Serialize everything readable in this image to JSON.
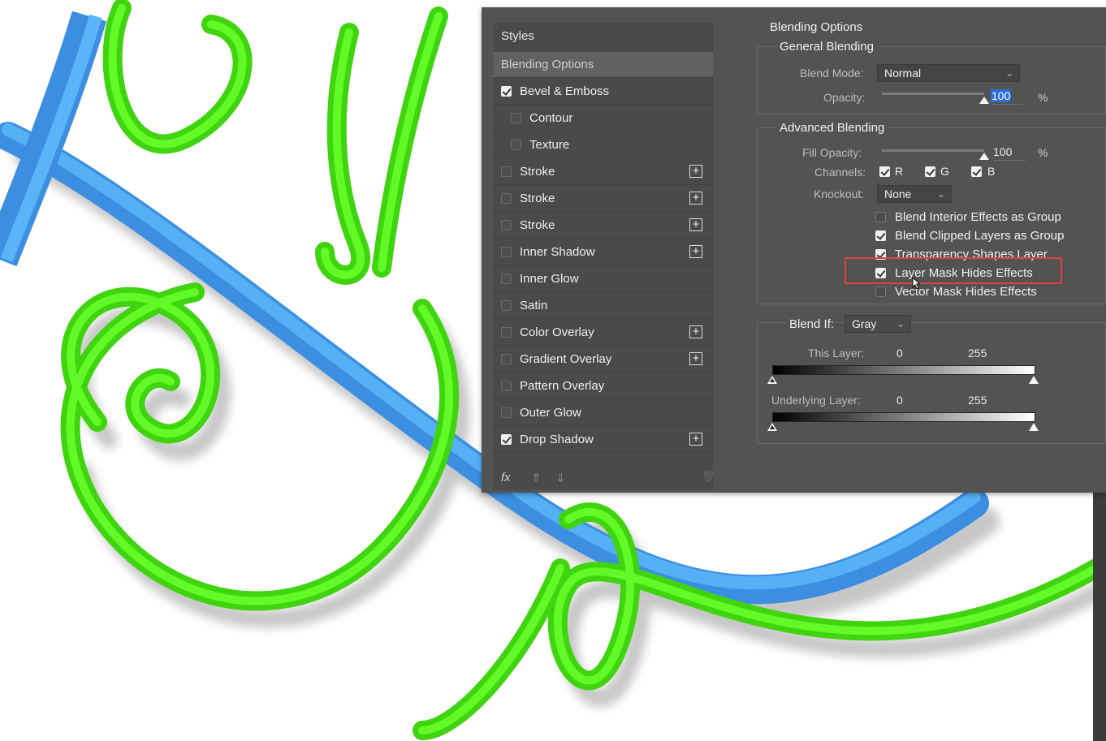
{
  "styles_panel": {
    "header": "Styles",
    "items": [
      {
        "label": "Blending Options",
        "checkbox": false,
        "checked": false,
        "plus": false,
        "selected": true,
        "indent": false
      },
      {
        "label": "Bevel & Emboss",
        "checkbox": true,
        "checked": true,
        "plus": false,
        "selected": false,
        "indent": false
      },
      {
        "label": "Contour",
        "checkbox": true,
        "checked": false,
        "plus": false,
        "selected": false,
        "indent": true
      },
      {
        "label": "Texture",
        "checkbox": true,
        "checked": false,
        "plus": false,
        "selected": false,
        "indent": true
      },
      {
        "label": "Stroke",
        "checkbox": true,
        "checked": false,
        "plus": true,
        "selected": false,
        "indent": false
      },
      {
        "label": "Stroke",
        "checkbox": true,
        "checked": false,
        "plus": true,
        "selected": false,
        "indent": false
      },
      {
        "label": "Stroke",
        "checkbox": true,
        "checked": false,
        "plus": true,
        "selected": false,
        "indent": false
      },
      {
        "label": "Inner Shadow",
        "checkbox": true,
        "checked": false,
        "plus": true,
        "selected": false,
        "indent": false
      },
      {
        "label": "Inner Glow",
        "checkbox": true,
        "checked": false,
        "plus": false,
        "selected": false,
        "indent": false
      },
      {
        "label": "Satin",
        "checkbox": true,
        "checked": false,
        "plus": false,
        "selected": false,
        "indent": false
      },
      {
        "label": "Color Overlay",
        "checkbox": true,
        "checked": false,
        "plus": true,
        "selected": false,
        "indent": false
      },
      {
        "label": "Gradient Overlay",
        "checkbox": true,
        "checked": false,
        "plus": true,
        "selected": false,
        "indent": false
      },
      {
        "label": "Pattern Overlay",
        "checkbox": true,
        "checked": false,
        "plus": false,
        "selected": false,
        "indent": false
      },
      {
        "label": "Outer Glow",
        "checkbox": true,
        "checked": false,
        "plus": false,
        "selected": false,
        "indent": false
      },
      {
        "label": "Drop Shadow",
        "checkbox": true,
        "checked": true,
        "plus": true,
        "selected": false,
        "indent": false
      }
    ],
    "plus_glyph": "+",
    "footer": {
      "fx": "fx",
      "up": "⇑",
      "down": "⇓",
      "trash": "🗑"
    }
  },
  "blending": {
    "title": "Blending Options",
    "general": {
      "title": "General Blending",
      "blend_mode_label": "Blend Mode:",
      "blend_mode_value": "Normal",
      "opacity_label": "Opacity:",
      "opacity_value": "100",
      "opacity_unit": "%",
      "opacity_level": 1.0
    },
    "advanced": {
      "title": "Advanced Blending",
      "fill_opacity_label": "Fill Opacity:",
      "fill_opacity_value": "100",
      "fill_opacity_unit": "%",
      "fill_opacity_level": 1.0,
      "channels_label": "Channels:",
      "channel_r": "R",
      "channel_g": "G",
      "channel_b": "B",
      "knockout_label": "Knockout:",
      "knockout_value": "None",
      "options": [
        {
          "label": "Blend Interior Effects as Group",
          "checked": false
        },
        {
          "label": "Blend Clipped Layers as Group",
          "checked": true
        },
        {
          "label": "Transparency Shapes Layer",
          "checked": true
        },
        {
          "label": "Layer Mask Hides Effects",
          "checked": true
        },
        {
          "label": "Vector Mask Hides Effects",
          "checked": false
        }
      ]
    },
    "blend_if": {
      "label": "Blend If:",
      "value": "Gray",
      "this_layer_label": "This Layer:",
      "this_layer_min": "0",
      "this_layer_max": "255",
      "underlying_label": "Underlying Layer:",
      "underlying_min": "0",
      "underlying_max": "255"
    }
  },
  "colors": {
    "dialog_bg": "#535353",
    "panel_bg": "#4a4a4a",
    "selected_bg": "#616161",
    "highlight_red": "#d9453c",
    "field_focus_blue": "#2b6fd6",
    "green_ribbon": "#55ee1d",
    "blue_ribbon": "#4aa5f2"
  }
}
